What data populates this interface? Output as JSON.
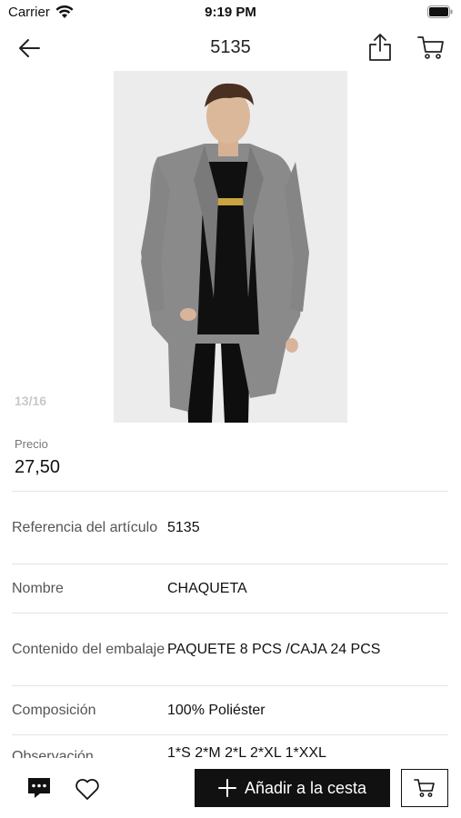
{
  "status_bar": {
    "carrier": "Carrier",
    "time": "9:19 PM"
  },
  "nav": {
    "title": "5135"
  },
  "gallery": {
    "counter": "13/16",
    "image_description_icon": "product-photo"
  },
  "price": {
    "label": "Precio",
    "value": "27,50"
  },
  "details": [
    {
      "label": "Referencia del artículo",
      "value": "5135"
    },
    {
      "label": "Nombre",
      "value": "CHAQUETA"
    },
    {
      "label": "Contenido del embalaje",
      "value": "PAQUETE 8 PCS /CAJA 24 PCS"
    },
    {
      "label": "Composición",
      "value": "100% Poliéster"
    },
    {
      "label": "Observación",
      "value": "1*S 2*M 2*L 2*XL 1*XXL"
    }
  ],
  "toolbar": {
    "add_to_cart_label": "Añadir a la cesta"
  },
  "colors": {
    "primary": "#111111",
    "divider": "#e4e4e4",
    "muted_text": "#777777"
  }
}
